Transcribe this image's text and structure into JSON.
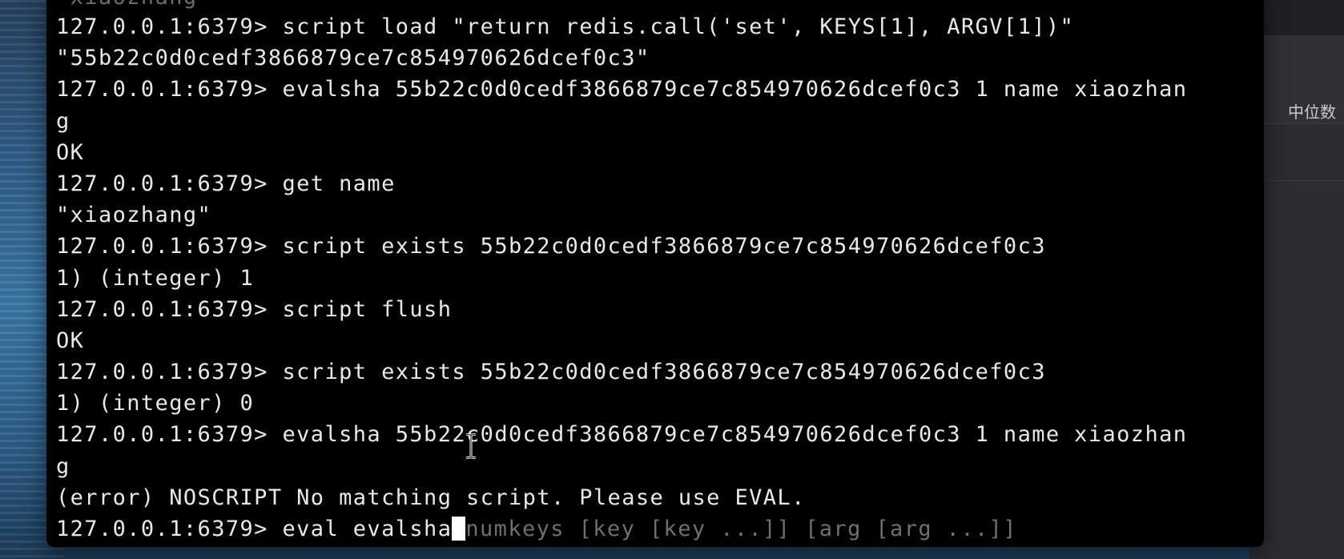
{
  "side_app": {
    "label": "中位数"
  },
  "terminal": {
    "lines": [
      "\"xiaozhang\"",
      "127.0.0.1:6379> script load \"return redis.call('set', KEYS[1], ARGV[1])\"",
      "\"55b22c0d0cedf3866879ce7c854970626dcef0c3\"",
      "127.0.0.1:6379> evalsha 55b22c0d0cedf3866879ce7c854970626dcef0c3 1 name xiaozhan",
      "g",
      "OK",
      "127.0.0.1:6379> get name",
      "\"xiaozhang\"",
      "127.0.0.1:6379> script exists 55b22c0d0cedf3866879ce7c854970626dcef0c3",
      "1) (integer) 1",
      "127.0.0.1:6379> script flush",
      "OK",
      "127.0.0.1:6379> script exists 55b22c0d0cedf3866879ce7c854970626dcef0c3",
      "1) (integer) 0",
      "127.0.0.1:6379> evalsha 55b22c0d0cedf3866879ce7c854970626dcef0c3 1 name xiaozhan",
      "g",
      "(error) NOSCRIPT No matching script. Please use EVAL."
    ],
    "input_prompt": "127.0.0.1:6379> ",
    "input_text": "eval evalsha",
    "input_hint": "numkeys [key [key ...]] [arg [arg ...]]"
  },
  "colors": {
    "terminal_bg": "#000000",
    "terminal_text": "#e8e8e8",
    "hint_text": "#6f6f6f",
    "cursor": "#ffffff"
  },
  "icons": [
    "text-cursor-icon"
  ]
}
